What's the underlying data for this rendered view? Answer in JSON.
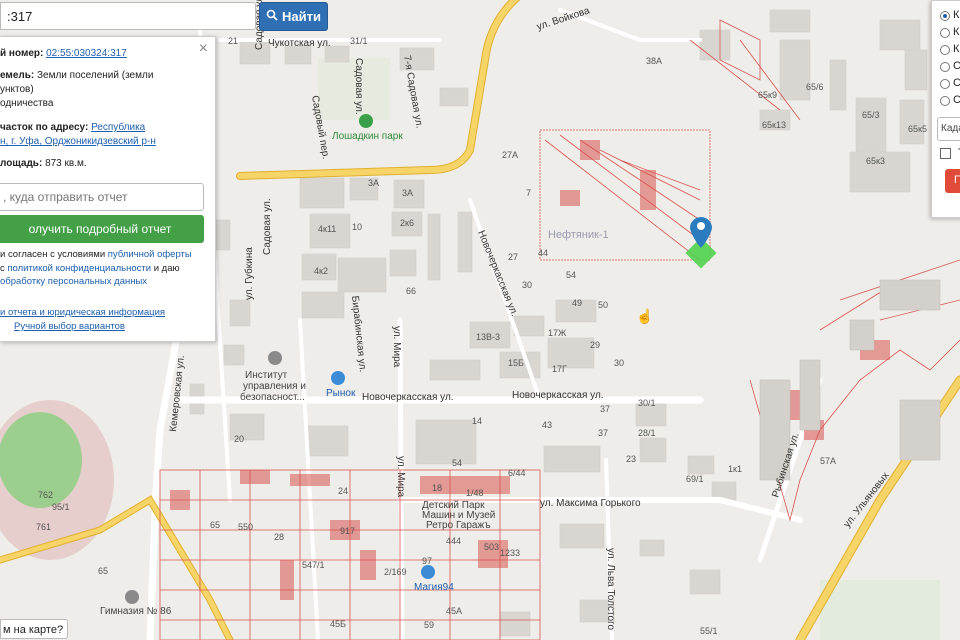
{
  "search": {
    "value": ":317",
    "button_label": "Найти"
  },
  "info_panel": {
    "cadastral_label": "й номер:",
    "cadastral_number": "02:55:030324:317",
    "category_label": "емель:",
    "category_value": "Земли поселений (земли",
    "category_line2": "унктов)",
    "category_line3": "одничества",
    "address_label": "часток по адресу:",
    "address_link1": "Республика",
    "address_link2": "н, г. Уфа, Орджоникидзевский р-н",
    "area_label": "лощадь:",
    "area_value": "873 кв.м.",
    "email_placeholder": ", куда отправить отчет",
    "report_button": "олучить подробный отчет",
    "consent_line1a": "и согласен с условиями",
    "consent_link1": "публичной оферты",
    "consent_line2a": "с",
    "consent_link2": "политикой конфиденциальности",
    "consent_line2b": "и даю",
    "consent_link3": "обработку персональных данных",
    "legal_link": "и отчета и юридическая информация",
    "manual_link": "Ручной выбор вариантов"
  },
  "right_panel": {
    "options": [
      "К",
      "К",
      "К",
      "С",
      "С",
      "С"
    ],
    "select_label": "Када",
    "checkbox_label": "Т",
    "button_label": "П"
  },
  "map_help": "м на карте?",
  "map": {
    "streets": [
      "Чукотская ул.",
      "ул. Войкова",
      "Садовая ул.",
      "Садовый пер.",
      "7-я Садовая ул.",
      "Садовая ул.",
      "Новочеркасская ул.",
      "Новочеркасская ул.",
      "Новочеркасская ул.",
      "Кемеровская ул.",
      "ул. Губкина",
      "Садовая ул.",
      "Бирабинская ул.",
      "ул. Мира",
      "ул. Мира",
      "ул. Максима Горького",
      "ул. Льва Толстого",
      "Рыбинская ул.",
      "ул. Ульяновых"
    ],
    "pois": [
      "Лошадкин парк",
      "Институт",
      "управления и",
      "безопасност...",
      "Рынок",
      "Нефтяник-1",
      "Детский Парк",
      "Машин и Музей",
      "Ретро Гаражъ",
      "Магия94",
      "Гимназия № 86"
    ],
    "numbers": [
      "21",
      "31/1",
      "38A",
      "65/6",
      "65к9",
      "65к13",
      "65/3",
      "65к3",
      "65к5",
      "4к11",
      "10",
      "3A",
      "2к6",
      "3A",
      "27A",
      "7",
      "44",
      "27",
      "54",
      "30",
      "49",
      "50",
      "4к2",
      "66",
      "13В-3",
      "15Б",
      "17Ж",
      "29",
      "17Г",
      "30",
      "37",
      "43",
      "37",
      "54",
      "30/1",
      "28/1",
      "23",
      "20",
      "1к1",
      "69/1",
      "14",
      "57A",
      "24",
      "18",
      "1/48",
      "6/44",
      "917",
      "28",
      "503",
      "1233",
      "444",
      "97",
      "45A",
      "45Б",
      "65",
      "65",
      "550",
      "762",
      "761",
      "95/1",
      "2/169",
      "547/1",
      "59",
      "55/1"
    ]
  },
  "colors": {
    "accent": "#2f6fb3",
    "report_green": "#43a047",
    "parcel_red": "#d9534f",
    "marker_blue": "#2b7bbf",
    "marker_green": "#4fd14f",
    "road_yellow": "#f1c232"
  }
}
